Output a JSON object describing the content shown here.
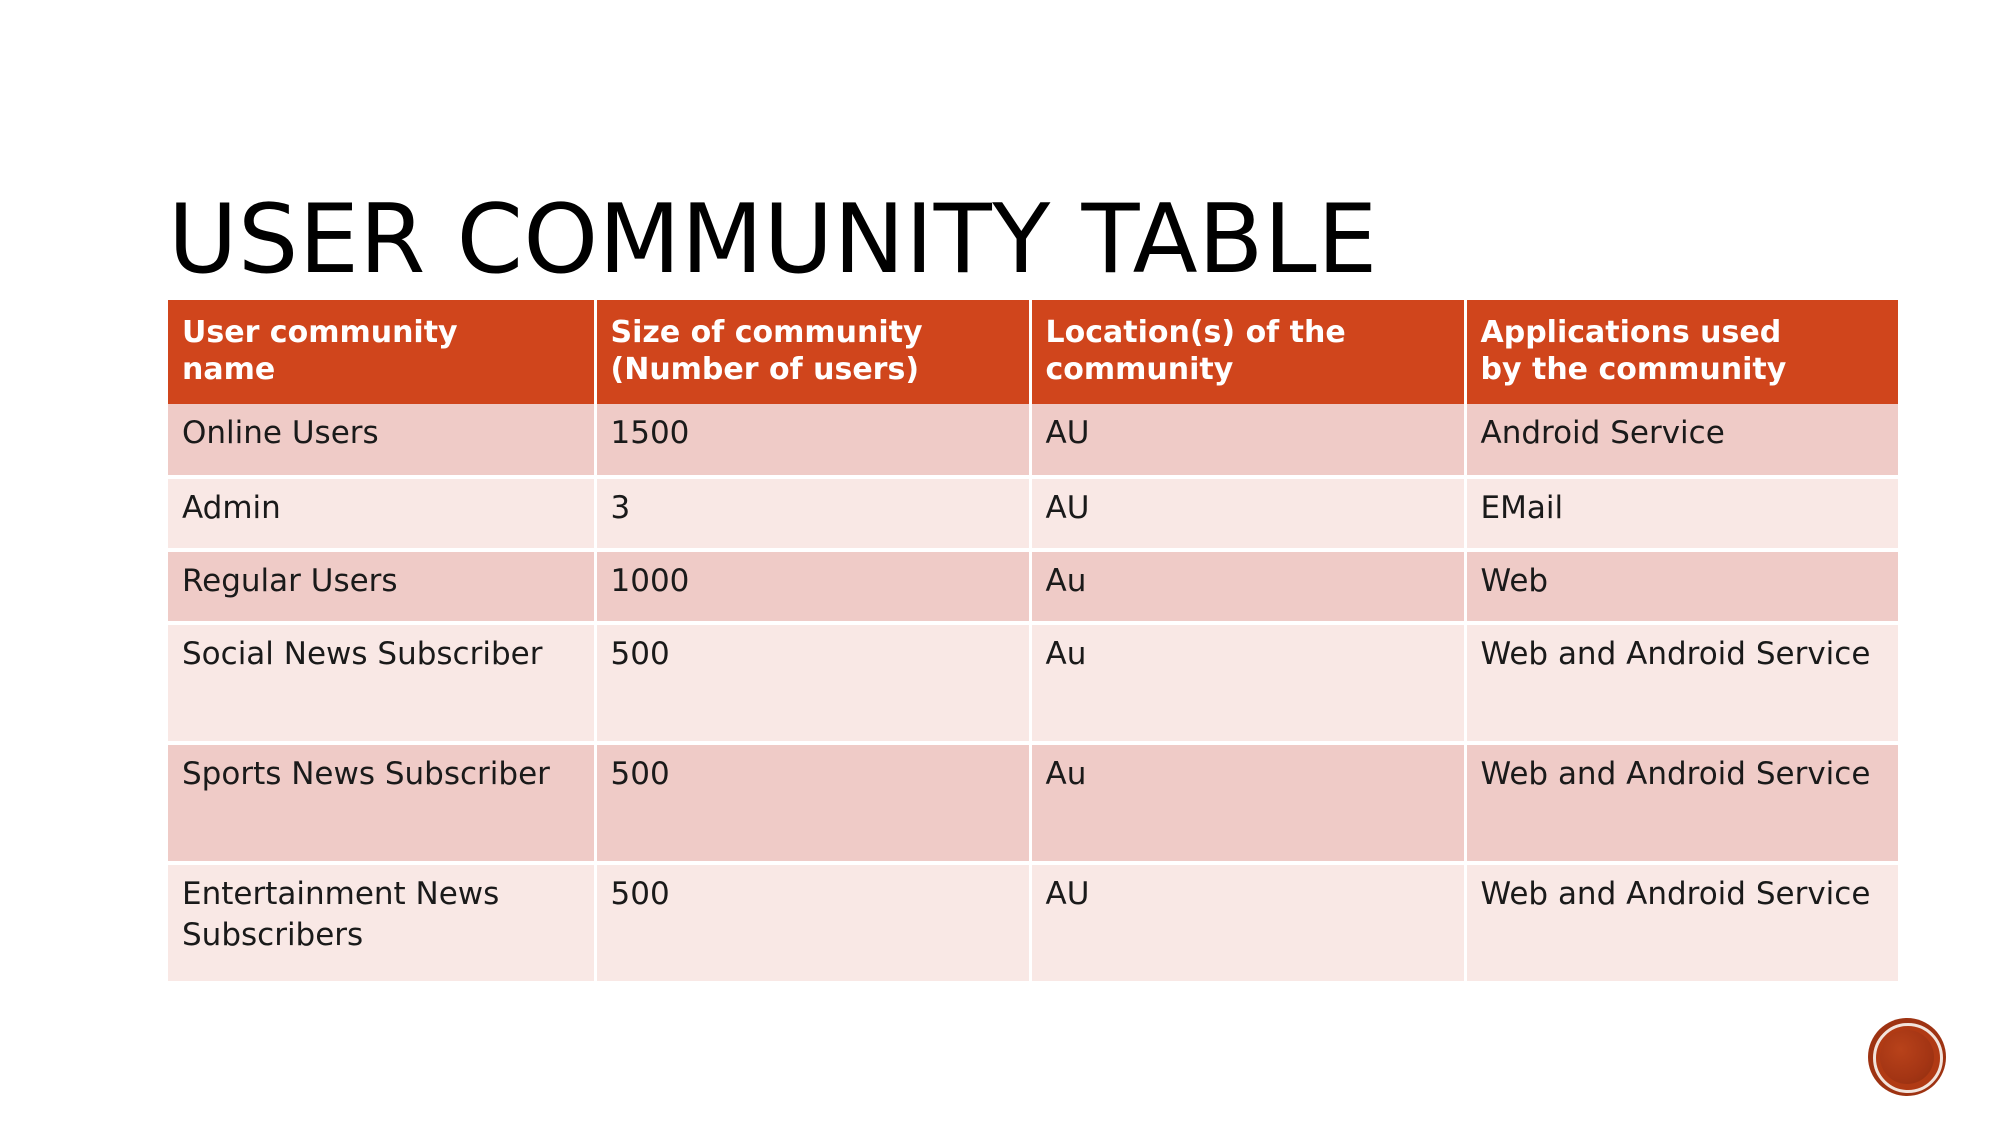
{
  "slide": {
    "title": "User Community Table",
    "background_color": "#FFFFFF"
  },
  "theme": {
    "header_background": "#D0451C",
    "header_text_color": "#FFFFFF",
    "row_band_dark": "#EFCBC7",
    "row_band_light": "#F9E8E5",
    "body_text_color": "#1A1A1A",
    "seal_color": "#A43514"
  },
  "table": {
    "name": "user-community-table",
    "columns": [
      "User community name",
      "Size of community (Number of users)",
      "Location(s) of the community",
      "Applications used by the community"
    ],
    "header_lines": {
      "col1_line1": "User community",
      "col1_line2": "name",
      "col2_line1": "Size of community",
      "col2_line2": "(Number of users)",
      "col3_line1": "Location(s) of the",
      "col3_line2": "community",
      "col4_line1": "Applications used",
      "col4_line2": "by the community"
    },
    "rows": [
      {
        "community_name": "Online Users",
        "size": "1500",
        "location": "AU",
        "applications": "Android Service"
      },
      {
        "community_name": "Admin",
        "size": "3",
        "location": "AU",
        "applications": "EMail"
      },
      {
        "community_name": "Regular Users",
        "size": "1000",
        "location": "Au",
        "applications": "Web"
      },
      {
        "community_name": "Social News Subscriber",
        "size": "500",
        "location": "Au",
        "applications": "Web and Android Service"
      },
      {
        "community_name": "Sports News Subscriber",
        "size": "500",
        "location": "Au",
        "applications": "Web and Android Service"
      },
      {
        "community_name": "Entertainment News Subscribers",
        "size": "500",
        "location": "AU",
        "applications": "Web and Android Service"
      }
    ]
  },
  "footer": {
    "seal_icon": "circular-seal-icon"
  }
}
